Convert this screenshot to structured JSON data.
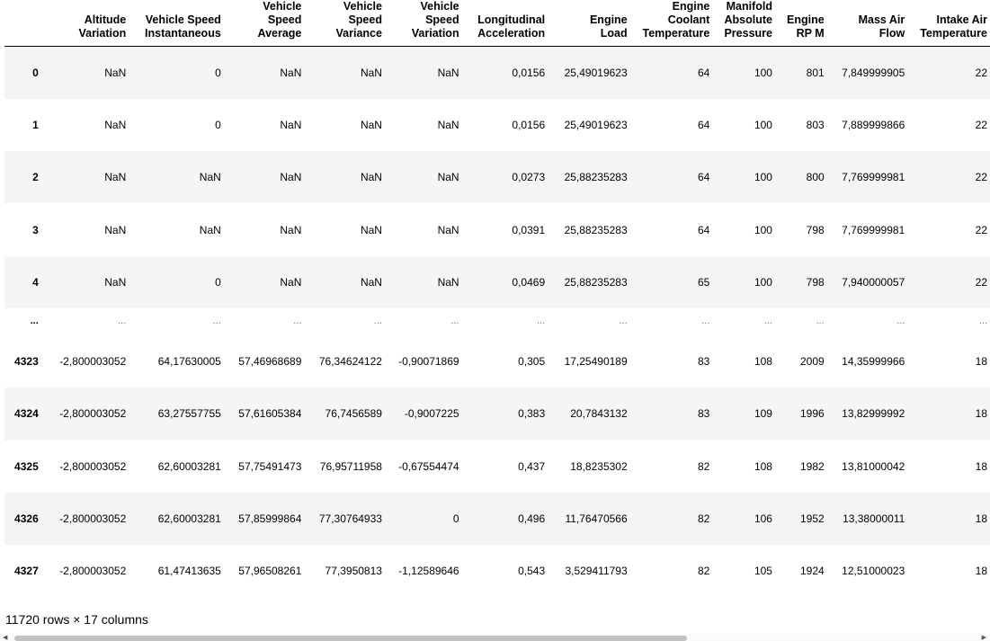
{
  "dataframe": {
    "columns": [
      "",
      "Altitude\nVariation",
      "Vehicle Speed\nInstantaneous",
      "Vehicle\nSpeed\nAverage",
      "Vehicle\nSpeed\nVariance",
      "Vehicle\nSpeed\nVariation",
      "Longitudinal\nAcceleration",
      "Engine\nLoad",
      "Engine\nCoolant\nTemperature",
      "Manifold\nAbsolute\nPressure",
      "Engine\nRP M",
      "Mass Air\nFlow",
      "Intake Air\nTemperature"
    ],
    "rows": [
      {
        "index": "0",
        "cells": [
          "NaN",
          "0",
          "NaN",
          "NaN",
          "NaN",
          "0,0156",
          "25,49019623",
          "64",
          "100",
          "801",
          "7,849999905",
          "22"
        ]
      },
      {
        "index": "1",
        "cells": [
          "NaN",
          "0",
          "NaN",
          "NaN",
          "NaN",
          "0,0156",
          "25,49019623",
          "64",
          "100",
          "803",
          "7,889999866",
          "22"
        ]
      },
      {
        "index": "2",
        "cells": [
          "NaN",
          "NaN",
          "NaN",
          "NaN",
          "NaN",
          "0,0273",
          "25,88235283",
          "64",
          "100",
          "800",
          "7,769999981",
          "22"
        ]
      },
      {
        "index": "3",
        "cells": [
          "NaN",
          "NaN",
          "NaN",
          "NaN",
          "NaN",
          "0,0391",
          "25,88235283",
          "64",
          "100",
          "798",
          "7,769999981",
          "22"
        ]
      },
      {
        "index": "4",
        "cells": [
          "NaN",
          "0",
          "NaN",
          "NaN",
          "NaN",
          "0,0469",
          "25,88235283",
          "65",
          "100",
          "798",
          "7,940000057",
          "22"
        ]
      },
      {
        "index": "...",
        "ellipsis": true,
        "cells": [
          "...",
          "...",
          "...",
          "...",
          "...",
          "...",
          "...",
          "...",
          "...",
          "...",
          "...",
          "..."
        ]
      },
      {
        "index": "4323",
        "cells": [
          "-2,800003052",
          "64,17630005",
          "57,46968689",
          "76,34624122",
          "-0,90071869",
          "0,305",
          "17,25490189",
          "83",
          "108",
          "2009",
          "14,35999966",
          "18"
        ]
      },
      {
        "index": "4324",
        "cells": [
          "-2,800003052",
          "63,27557755",
          "57,61605384",
          "76,7456589",
          "-0,9007225",
          "0,383",
          "20,7843132",
          "83",
          "109",
          "1996",
          "13,82999992",
          "18"
        ]
      },
      {
        "index": "4325",
        "cells": [
          "-2,800003052",
          "62,60003281",
          "57,75491473",
          "76,95711958",
          "-0,67554474",
          "0,437",
          "18,8235302",
          "82",
          "108",
          "1982",
          "13,81000042",
          "18"
        ]
      },
      {
        "index": "4326",
        "cells": [
          "-2,800003052",
          "62,60003281",
          "57,85999864",
          "77,30764933",
          "0",
          "0,496",
          "11,76470566",
          "82",
          "106",
          "1952",
          "13,38000011",
          "18"
        ]
      },
      {
        "index": "4327",
        "cells": [
          "-2,800003052",
          "61,47413635",
          "57,96508261",
          "77,3950813",
          "-1,12589646",
          "0,543",
          "3,529411793",
          "82",
          "105",
          "1924",
          "12,51000023",
          "18"
        ]
      }
    ],
    "shape_text": "11720 rows × 17 columns"
  },
  "scrollbar": {
    "progress_fraction": 0.7
  }
}
